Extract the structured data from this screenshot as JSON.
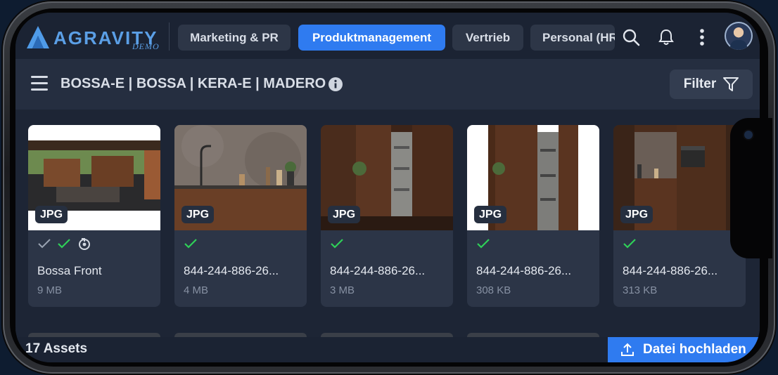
{
  "app": {
    "logo_text": "AGRAVITY",
    "logo_sub": "DEMO"
  },
  "tabs": [
    {
      "label": "Marketing & PR",
      "active": false
    },
    {
      "label": "Produktmanagement",
      "active": true
    },
    {
      "label": "Vertrieb",
      "active": false
    },
    {
      "label": "Personal (HR)",
      "active": false
    }
  ],
  "header_icons": [
    "search-icon",
    "bell-icon",
    "more-vertical-icon",
    "avatar"
  ],
  "collection": {
    "breadcrumb": "BOSSA-E | BOSSA | KERA-E | MADERO",
    "filter_label": "Filter"
  },
  "assets": [
    {
      "type": "JPG",
      "title": "Bossa Front",
      "size": "9 MB",
      "status": [
        "check-grey",
        "check-green",
        "sync-icon"
      ]
    },
    {
      "type": "JPG",
      "title": "844-244-886-26...",
      "size": "4 MB",
      "status": [
        "check-green"
      ]
    },
    {
      "type": "JPG",
      "title": "844-244-886-26...",
      "size": "3 MB",
      "status": [
        "check-green"
      ]
    },
    {
      "type": "JPG",
      "title": "844-244-886-26...",
      "size": "308 KB",
      "status": [
        "check-green"
      ]
    },
    {
      "type": "JPG",
      "title": "844-244-886-26...",
      "size": "313 KB",
      "status": [
        "check-green"
      ]
    }
  ],
  "footer": {
    "count": "17 Assets",
    "upload_label": "Datei hochladen"
  },
  "colors": {
    "accent": "#2f7bf0",
    "background": "#1d2535",
    "check_green": "#2fd058"
  }
}
